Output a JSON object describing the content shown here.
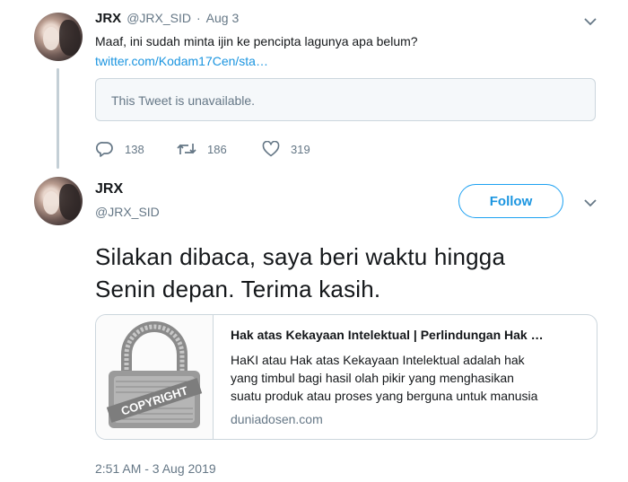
{
  "reply_tweet": {
    "display_name": "JRX",
    "handle": "@JRX_SID",
    "separator": "·",
    "date": "Aug 3",
    "text": "Maaf, ini sudah minta ijin ke pencipta lagunya apa belum?",
    "link": "twitter.com/Kodam17Cen/sta…",
    "quote_unavailable": "This Tweet is unavailable.",
    "reply_count": "138",
    "retweet_count": "186",
    "like_count": "319"
  },
  "main_tweet": {
    "display_name": "JRX",
    "handle": "@JRX_SID",
    "follow_label": "Follow",
    "text_line1": "Silakan dibaca, saya beri waktu hingga",
    "text_line2": "Senin depan. Terima kasih.",
    "card": {
      "image_text": "COPYRIGHT",
      "title": "Hak atas Kekayaan Intelektual | Perlindungan Hak …",
      "description_lines": [
        "HaKI atau Hak atas Kekayaan Intelektual adalah hak",
        "yang timbul bagi hasil olah pikir yang menghasikan",
        "suatu produk atau proses yang berguna untuk manusia"
      ],
      "domain": "duniadosen.com"
    },
    "timestamp": "2:51 AM - 3 Aug 2019"
  },
  "colors": {
    "accent": "#1da1f2",
    "link": "#1b95e0",
    "muted": "#657786",
    "border": "#ccd6dd"
  },
  "icons": [
    "avatar",
    "chevron-down-icon",
    "reply-icon",
    "retweet-icon",
    "heart-icon",
    "padlock-copyright-image"
  ]
}
